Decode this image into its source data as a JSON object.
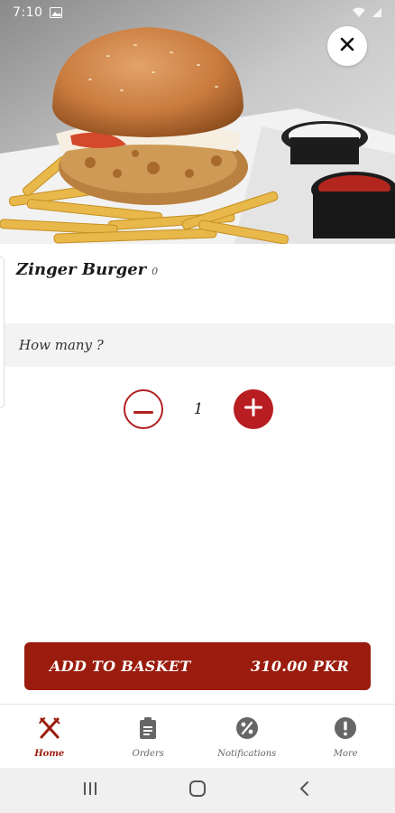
{
  "status_bar": {
    "time": "7:10"
  },
  "product": {
    "name": "Zinger Burger",
    "count": "0"
  },
  "quantity": {
    "label": "How many ?",
    "value": "1"
  },
  "basket": {
    "label": "ADD TO BASKET",
    "price": "310.00 PKR"
  },
  "nav": {
    "items": [
      {
        "label": "Home",
        "icon": "fork-knife-icon",
        "active": true
      },
      {
        "label": "Orders",
        "icon": "clipboard-icon",
        "active": false
      },
      {
        "label": "Notifications",
        "icon": "percent-badge-icon",
        "active": false
      },
      {
        "label": "More",
        "icon": "more-info-icon",
        "active": false
      }
    ]
  },
  "colors": {
    "accent": "#9a1c0e",
    "plus": "#b81d22",
    "nav_inactive": "#666666"
  }
}
